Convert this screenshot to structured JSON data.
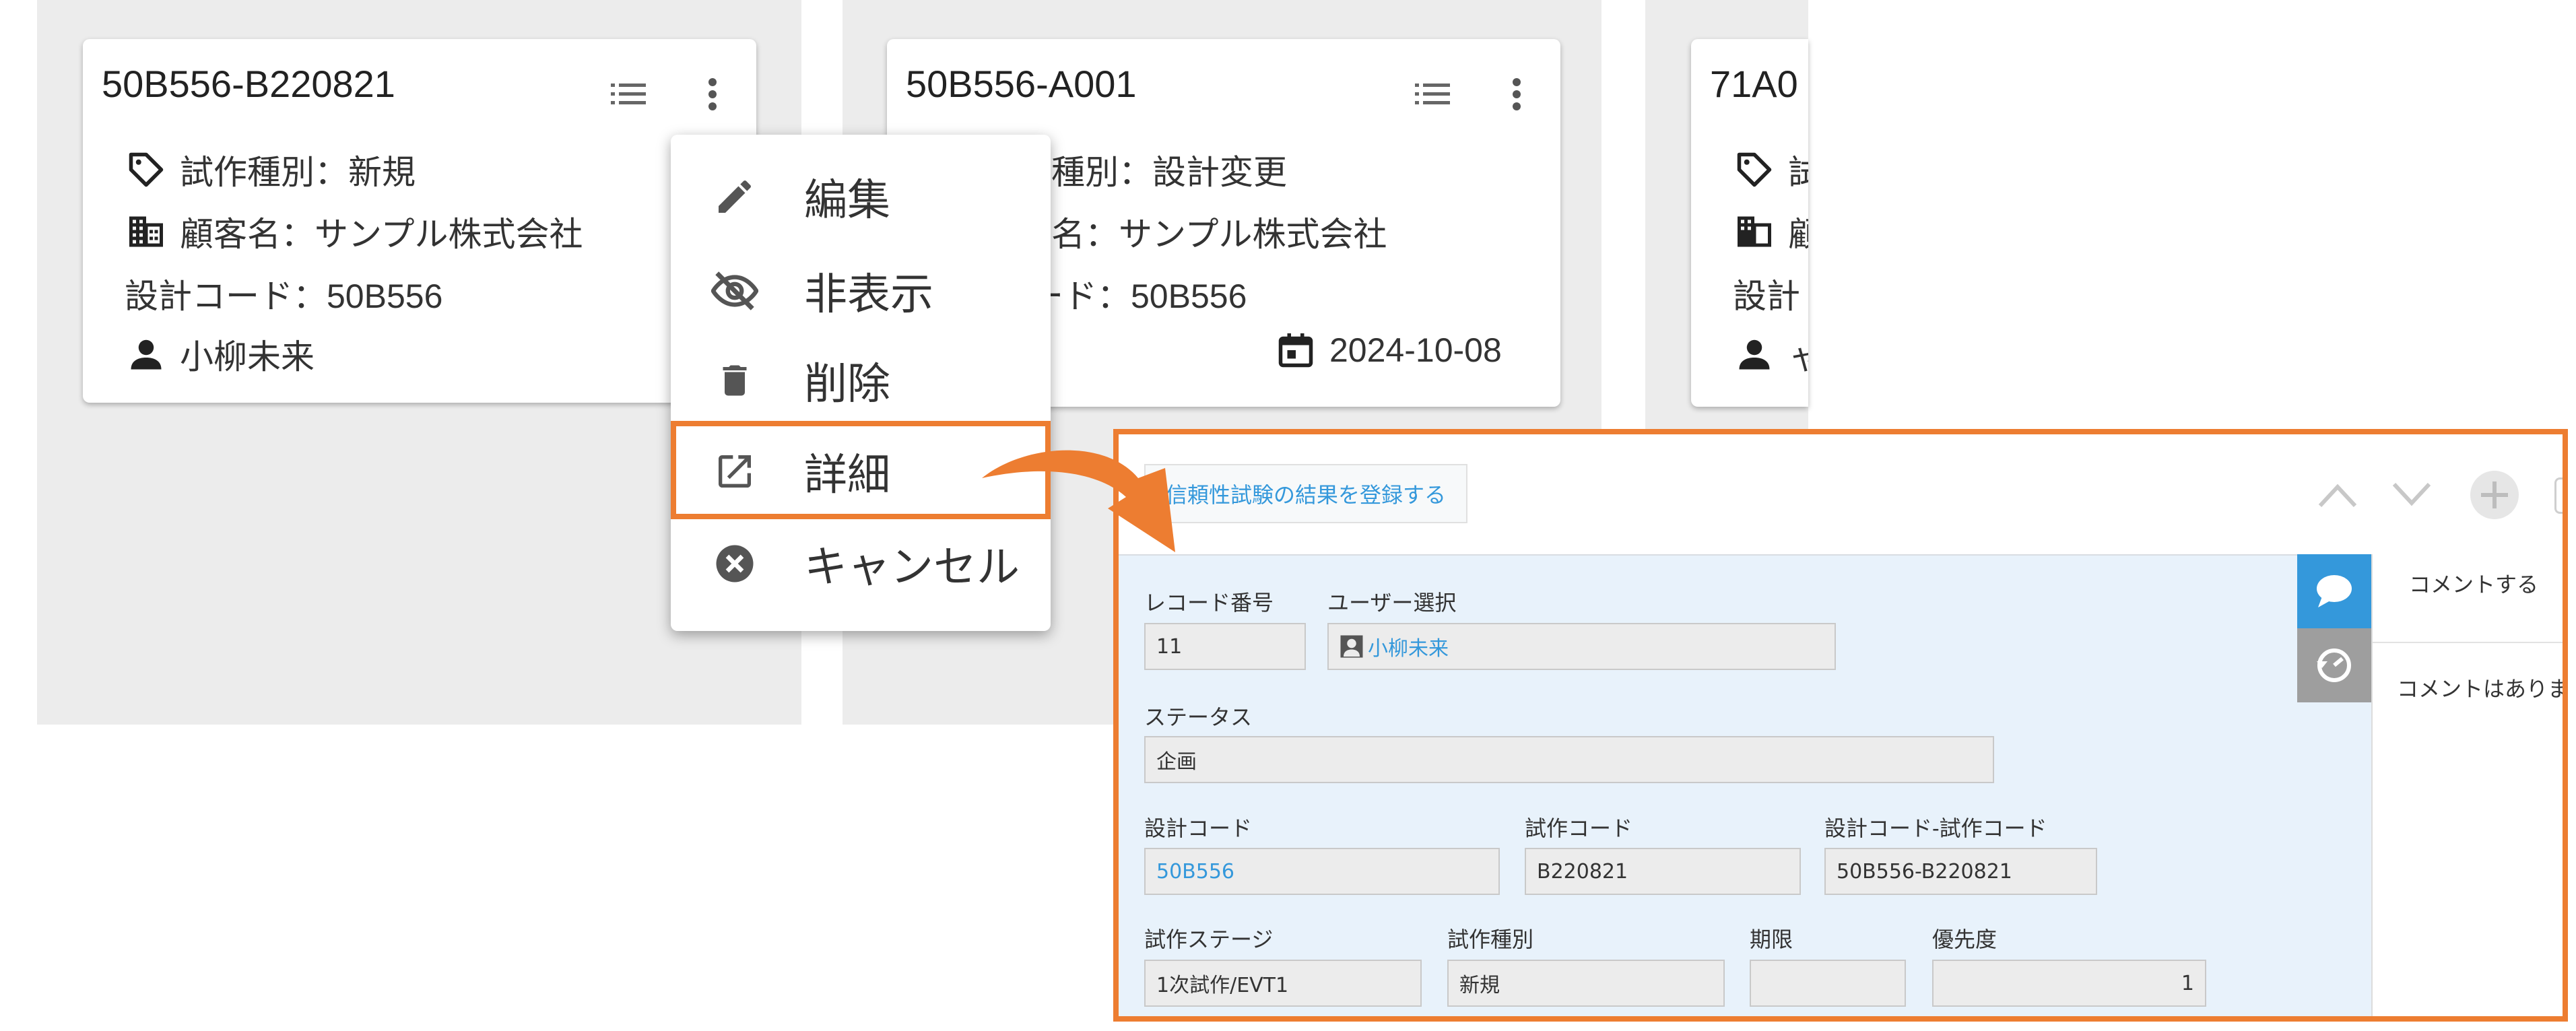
{
  "cards": [
    {
      "title": "50B556-B220821",
      "type": "試作種別：新規",
      "customer": "顧客名：サンプル株式会社",
      "design_code": "設計コード：50B556",
      "user": "小柳未来"
    },
    {
      "title": "50B556-A001",
      "type": "試作種別：設計変更",
      "customer": "顧客名：サンプル株式会社",
      "design_code": "設計コード：50B556",
      "date": "2024-10-08"
    },
    {
      "title": "71A0",
      "type": "試",
      "customer": "顧",
      "design_code": "設計",
      "user": "ャ"
    }
  ],
  "menu": {
    "items": [
      {
        "label": "編集",
        "icon": "pencil-icon"
      },
      {
        "label": "非表示",
        "icon": "eye-off-icon"
      },
      {
        "label": "削除",
        "icon": "trash-icon"
      },
      {
        "label": "詳細",
        "icon": "open-in-new-icon"
      },
      {
        "label": "キャンセル",
        "icon": "cancel-icon"
      }
    ],
    "highlighted": "詳細"
  },
  "detail": {
    "action_button": "信頼性試験の結果を登録する",
    "fields": {
      "record_no_label": "レコード番号",
      "record_no": "11",
      "user_select_label": "ユーザー選択",
      "user_select": "小柳未来",
      "status_label": "ステータス",
      "status": "企画",
      "design_code_label": "設計コード",
      "design_code": "50B556",
      "proto_code_label": "試作コード",
      "proto_code": "B220821",
      "combined_code_label": "設計コード-試作コード",
      "combined_code": "50B556-B220821",
      "stage_label": "試作ステージ",
      "stage": "1次試作/EVT1",
      "proto_type_label": "試作種別",
      "proto_type": "新規",
      "deadline_label": "期限",
      "deadline": "",
      "priority_label": "優先度",
      "priority": "1"
    },
    "comment_button": "コメントする",
    "comment_empty": "コメントはありま"
  },
  "colors": {
    "highlight": "#ed7d31",
    "link": "#3498db",
    "form_bg": "#e8f2fb",
    "active_tab": "#3498db",
    "inactive_tab": "#9e9e9e"
  }
}
